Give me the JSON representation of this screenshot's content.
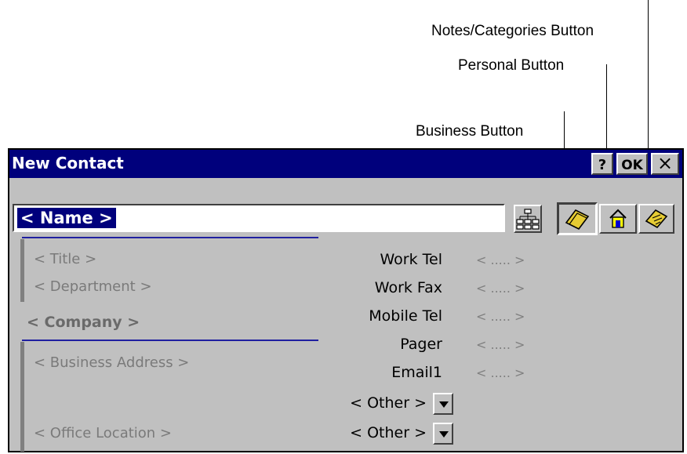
{
  "callouts": {
    "notes": "Notes/Categories Button",
    "personal": "Personal Button",
    "business": "Business Button"
  },
  "window": {
    "title": "New Contact",
    "help_label": "?",
    "ok_label": "OK",
    "close_label": "×"
  },
  "name_field": {
    "value": "< Name >"
  },
  "left_fields": {
    "title": "< Title >",
    "department": "< Department >",
    "company": "< Company >",
    "business_address": "< Business Address >",
    "office_location": "< Office Location >"
  },
  "phone_fields": [
    {
      "label": "Work Tel",
      "value": "< ..... >"
    },
    {
      "label": "Work Fax",
      "value": "< ..... >"
    },
    {
      "label": "Mobile Tel",
      "value": "< ..... >"
    },
    {
      "label": "Pager",
      "value": "< ..... >"
    },
    {
      "label": "Email1",
      "value": "< ..... >"
    }
  ],
  "other_fields": [
    {
      "label": "< Other >"
    },
    {
      "label": "< Other >"
    }
  ],
  "icons": {
    "address_book": "address-book-icon",
    "business": "folder-icon",
    "personal": "house-icon",
    "notes": "notes-icon"
  }
}
